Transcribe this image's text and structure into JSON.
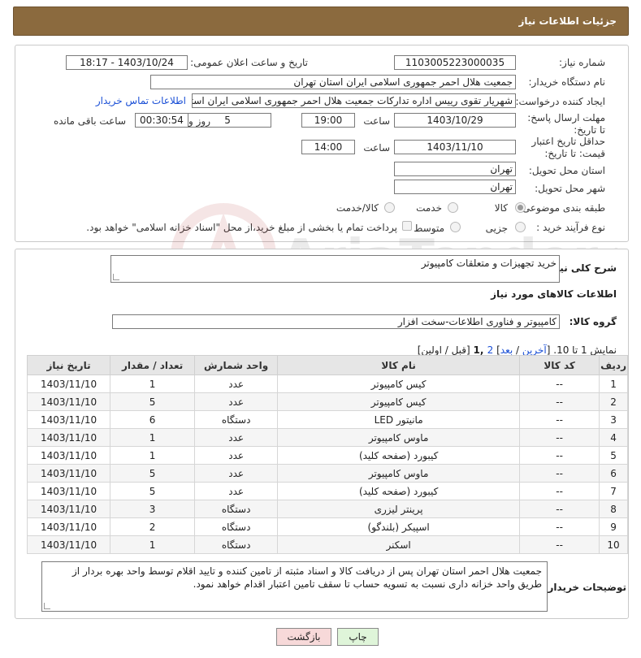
{
  "header": {
    "title": "جزئیات اطلاعات نیاز"
  },
  "form": {
    "need_number_label": "شماره نیاز:",
    "need_number": "1103005223000035",
    "announce_label": "تاریخ و ساعت اعلان عمومی:",
    "announce_value": "1403/10/24 - 18:17",
    "buyer_org_label": "نام دستگاه خریدار:",
    "buyer_org": "جمعیت هلال احمر جمهوری اسلامی ایران استان تهران",
    "creator_label": "ایجاد کننده درخواست:",
    "creator": "شهریار تقوی رییس اداره تدارکات جمعیت هلال احمر جمهوری اسلامی ایران استا",
    "contact_link": "اطلاعات تماس خریدار",
    "deadline_label": "مهلت ارسال پاسخ: تا تاریخ:",
    "deadline_date": "1403/10/29",
    "time_label": "ساعت",
    "deadline_time": "19:00",
    "days_value": "5",
    "days_label": "روز و",
    "remaining_value": "00:30:54",
    "remaining_label": "ساعت باقی مانده",
    "validity_label": "حداقل تاریخ اعتبار قیمت: تا تاریخ:",
    "validity_date": "1403/11/10",
    "validity_time_label": "ساعت",
    "validity_time": "14:00",
    "province_label": "استان محل تحویل:",
    "province": "تهران",
    "city_label": "شهر محل تحویل:",
    "city": "تهران",
    "category_label": "طبقه بندی موضوعی:",
    "category_options": [
      "کالا",
      "خدمت",
      "کالا/خدمت"
    ],
    "process_label": "نوع فرآیند خرید :",
    "process_options": [
      "جزیی",
      "متوسط"
    ],
    "payment_note": "پرداخت تمام یا بخشی از مبلغ خرید،از محل \"اسناد خزانه اسلامی\" خواهد بود."
  },
  "details": {
    "desc_label": "شرح کلی نیاز:",
    "desc_value": "خرید تجهیزات و متعلقات کامپیوتر",
    "goods_info_title": "اطلاعات کالاهای مورد نیاز",
    "group_label": "گروه کالا:",
    "group_value": "کامپیوتر و فناوری اطلاعات-سخت افزار",
    "pagination": {
      "prefix": "نمایش 1 تا 10. [",
      "last": "آخرین",
      "sep1": " / ",
      "next": "بعد",
      "sep2": "] ",
      "page2": "2",
      "page1": " ,1",
      "suffix": " [قبل / اولین]"
    },
    "table": {
      "headers": [
        "ردیف",
        "کد کالا",
        "نام کالا",
        "واحد شمارش",
        "تعداد / مقدار",
        "تاریخ نیاز"
      ],
      "rows": [
        [
          "1",
          "--",
          "کیس کامپیوتر",
          "عدد",
          "1",
          "1403/11/10"
        ],
        [
          "2",
          "--",
          "کیس کامپیوتر",
          "عدد",
          "5",
          "1403/11/10"
        ],
        [
          "3",
          "--",
          "مانیتور LED",
          "دستگاه",
          "6",
          "1403/11/10"
        ],
        [
          "4",
          "--",
          "ماوس کامپیوتر",
          "عدد",
          "1",
          "1403/11/10"
        ],
        [
          "5",
          "--",
          "کیبورد (صفحه کلید)",
          "عدد",
          "1",
          "1403/11/10"
        ],
        [
          "6",
          "--",
          "ماوس کامپیوتر",
          "عدد",
          "5",
          "1403/11/10"
        ],
        [
          "7",
          "--",
          "کیبورد (صفحه کلید)",
          "عدد",
          "5",
          "1403/11/10"
        ],
        [
          "8",
          "--",
          "پرینتر لیزری",
          "دستگاه",
          "3",
          "1403/11/10"
        ],
        [
          "9",
          "--",
          "اسپیکر (بلندگو)",
          "دستگاه",
          "2",
          "1403/11/10"
        ],
        [
          "10",
          "--",
          "اسکنر",
          "دستگاه",
          "1",
          "1403/11/10"
        ]
      ]
    },
    "buyer_notes_label": "توضیحات خریدار:",
    "buyer_notes": "جمعیت هلال احمر استان تهران پس از دریافت کالا و اسناد مثبته از تامین کننده و تایید اقلام توسط واحد بهره بردار از طریق واحد خزانه داری نسبت به تسویه حساب تا سقف تامین اعتبار اقدام خواهد نمود."
  },
  "buttons": {
    "print": "چاپ",
    "back": "بازگشت"
  },
  "watermark": {
    "text": "AriaTender.net"
  },
  "colors": {
    "header_bg": "#8b6a3e",
    "link": "#1a4fd6",
    "back_btn": "#f7d9d9",
    "print_btn": "#dff5d9"
  }
}
